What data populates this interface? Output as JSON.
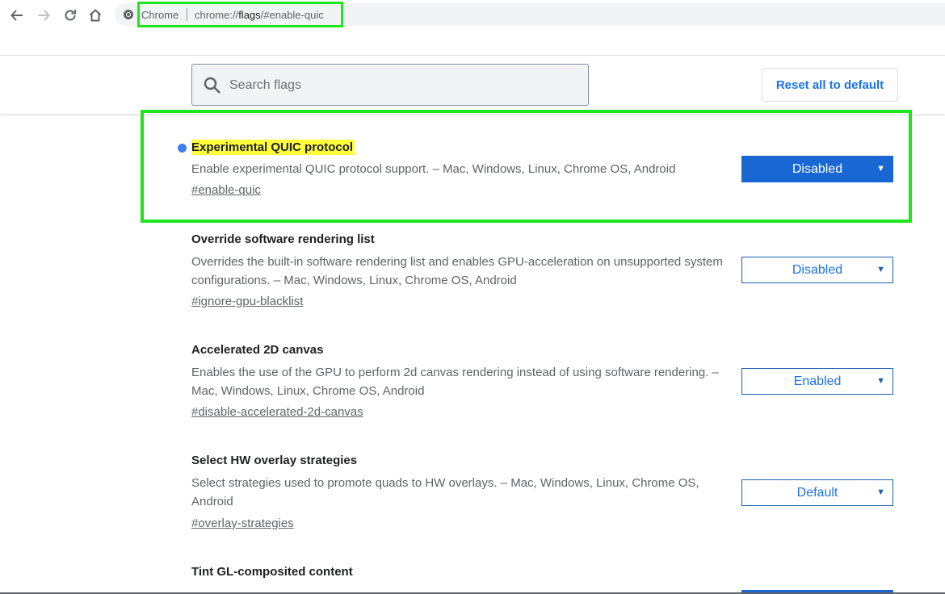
{
  "toolbar": {
    "back_icon": "arrow-left-icon",
    "forward_icon": "arrow-right-icon",
    "reload_icon": "reload-icon",
    "home_icon": "home-icon",
    "site_chip": "Chrome",
    "url_scheme": "chrome://",
    "url_host": "flags",
    "url_path": "/#enable-quic"
  },
  "header": {
    "search_placeholder": "Search flags",
    "reset_label": "Reset all to default"
  },
  "flags": [
    {
      "title": "Experimental QUIC protocol",
      "description": "Enable experimental QUIC protocol support. – Mac, Windows, Linux, Chrome OS, Android",
      "link": "#enable-quic",
      "value": "Disabled"
    },
    {
      "title": "Override software rendering list",
      "description": "Overrides the built-in software rendering list and enables GPU-acceleration on unsupported system configurations. – Mac, Windows, Linux, Chrome OS, Android",
      "link": "#ignore-gpu-blacklist",
      "value": "Disabled"
    },
    {
      "title": "Accelerated 2D canvas",
      "description": "Enables the use of the GPU to perform 2d canvas rendering instead of using software rendering. – Mac, Windows, Linux, Chrome OS, Android",
      "link": "#disable-accelerated-2d-canvas",
      "value": "Enabled"
    },
    {
      "title": "Select HW overlay strategies",
      "description": "Select strategies used to promote quads to HW overlays. – Mac, Windows, Linux, Chrome OS, Android",
      "link": "#overlay-strategies",
      "value": "Default"
    },
    {
      "title": "Tint GL-composited content"
    }
  ],
  "colors": {
    "accent": "#1a73e8",
    "highlight_box": "#1ee61e",
    "title_highlight": "#ffff3a",
    "modified_dot": "#3d80ea"
  }
}
